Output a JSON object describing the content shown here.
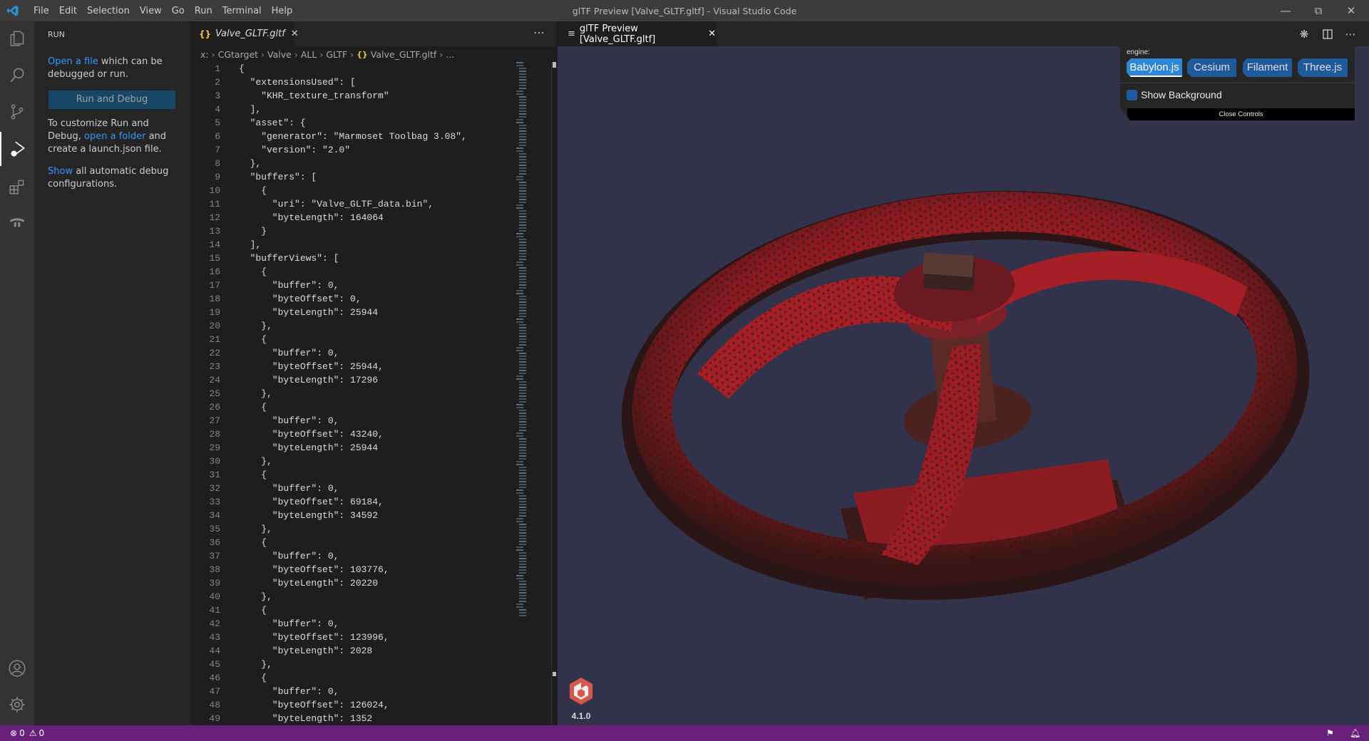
{
  "window": {
    "title": "glTF Preview [Valve_GLTF.gltf] - Visual Studio Code"
  },
  "menu": [
    "File",
    "Edit",
    "Selection",
    "View",
    "Go",
    "Run",
    "Terminal",
    "Help"
  ],
  "activity_icons": [
    "files-icon",
    "search-icon",
    "source-control-icon",
    "run-debug-icon",
    "extensions-icon",
    "terraform-icon"
  ],
  "sidebar": {
    "header": "RUN",
    "open_file_link": "Open a file",
    "open_file_rest": " which can be debugged or run.",
    "run_button": "Run and Debug",
    "customize_pre": "To customize Run and Debug, ",
    "open_folder_link": "open a folder",
    "customize_post": " and create a launch.json file.",
    "show_link": "Show",
    "show_rest": " all automatic debug configurations."
  },
  "editor": {
    "tab_label": "Valve_GLTF.gltf",
    "breadcrumb": [
      "x:",
      "CGtarget",
      "Valve",
      "ALL",
      "GLTF",
      "Valve_GLTF.gltf",
      "..."
    ],
    "lines": [
      "{",
      "  \"extensionsUsed\": [",
      "    \"KHR_texture_transform\"",
      "  ],",
      "  \"asset\": {",
      "    \"generator\": \"Marmoset Toolbag 3.08\",",
      "    \"version\": \"2.0\"",
      "  },",
      "  \"buffers\": [",
      "    {",
      "      \"uri\": \"Valve_GLTF_data.bin\",",
      "      \"byteLength\": 164064",
      "    }",
      "  ],",
      "  \"bufferViews\": [",
      "    {",
      "      \"buffer\": 0,",
      "      \"byteOffset\": 0,",
      "      \"byteLength\": 25944",
      "    },",
      "    {",
      "      \"buffer\": 0,",
      "      \"byteOffset\": 25944,",
      "      \"byteLength\": 17296",
      "    },",
      "    {",
      "      \"buffer\": 0,",
      "      \"byteOffset\": 43240,",
      "      \"byteLength\": 25944",
      "    },",
      "    {",
      "      \"buffer\": 0,",
      "      \"byteOffset\": 69184,",
      "      \"byteLength\": 34592",
      "    },",
      "    {",
      "      \"buffer\": 0,",
      "      \"byteOffset\": 103776,",
      "      \"byteLength\": 20220",
      "    },",
      "    {",
      "      \"buffer\": 0,",
      "      \"byteOffset\": 123996,",
      "      \"byteLength\": 2028",
      "    },",
      "    {",
      "      \"buffer\": 0,",
      "      \"byteOffset\": 126024,",
      "      \"byteLength\": 1352"
    ]
  },
  "preview": {
    "tab_label": "glTF Preview [Valve_GLTF.gltf]",
    "controls": {
      "engine_label": "engine:",
      "engines": [
        "Babylon.js",
        "Cesium",
        "Filament",
        "Three.js"
      ],
      "selected_engine": "Babylon.js",
      "show_background_label": "Show Background",
      "show_background_checked": false,
      "close_label": "Close Controls"
    },
    "engine_version": "4.1.0",
    "background_color": "#32324a"
  },
  "statusbar": {
    "errors": "0",
    "warnings": "0",
    "color": "#68217a"
  }
}
